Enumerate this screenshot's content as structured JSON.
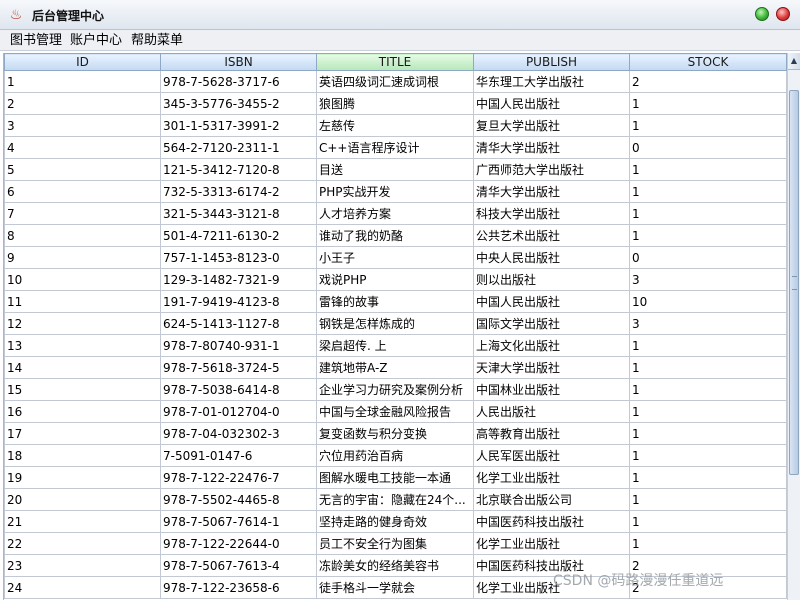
{
  "window": {
    "title": "后台管理中心"
  },
  "menu": {
    "items": [
      "图书管理",
      "账户中心",
      "帮助菜单"
    ]
  },
  "table": {
    "columns": [
      "ID",
      "ISBN",
      "TITLE",
      "PUBLISH",
      "STOCK"
    ],
    "sorted_column": "TITLE",
    "rows": [
      [
        "1",
        "978-7-5628-3717-6",
        "英语四级词汇速成词根",
        " 华东理工大学出版社",
        "2"
      ],
      [
        "2",
        "345-3-5776-3455-2",
        "狼图腾",
        "中国人民出版社",
        "1"
      ],
      [
        "3",
        "301-1-5317-3991-2",
        "左慈传",
        "复旦大学出版社",
        "1"
      ],
      [
        "4",
        "564-2-7120-2311-1",
        "C++语言程序设计",
        "清华大学出版社",
        "0"
      ],
      [
        "5",
        "121-5-3412-7120-8",
        "目送",
        "广西师范大学出版社",
        "1"
      ],
      [
        "6",
        "732-5-3313-6174-2",
        "PHP实战开发",
        "清华大学出版社",
        "1"
      ],
      [
        "7",
        "321-5-3443-3121-8",
        "人才培养方案",
        "科技大学出版社",
        "1"
      ],
      [
        "8",
        "501-4-7211-6130-2",
        "谁动了我的奶酪",
        "公共艺术出版社",
        "1"
      ],
      [
        "9",
        "757-1-1453-8123-0",
        "小王子",
        "中央人民出版社",
        "0"
      ],
      [
        "10",
        "129-3-1482-7321-9",
        "戏说PHP",
        "则以出版社",
        "3"
      ],
      [
        "11",
        "191-7-9419-4123-8",
        "雷锋的故事",
        "中国人民出版社",
        "10"
      ],
      [
        "12",
        "624-5-1413-1127-8",
        "钢铁是怎样炼成的",
        "国际文学出版社",
        "3"
      ],
      [
        "13",
        "978-7-80740-931-1",
        "梁启超传. 上",
        " 上海文化出版社",
        "1"
      ],
      [
        "14",
        "978-7-5618-3724-5",
        "建筑地带A-Z",
        " 天津大学出版社",
        "1"
      ],
      [
        "15",
        "978-7-5038-6414-8",
        "企业学习力研究及案例分析",
        "中国林业出版社",
        "1"
      ],
      [
        "16",
        "978-7-01-012704-0",
        "中国与全球金融风险报告",
        "人民出版社",
        "1"
      ],
      [
        "17",
        "978-7-04-032302-3",
        "复变函数与积分变换",
        "高等教育出版社",
        "1"
      ],
      [
        "18",
        "7-5091-0147-6",
        "穴位用药治百病",
        "人民军医出版社",
        "1"
      ],
      [
        "19",
        "978-7-122-22476-7",
        "图解水暖电工技能一本通",
        " 化学工业出版社",
        "1"
      ],
      [
        "20",
        "978-7-5502-4465-8",
        "无言的宇宙：隐藏在24个...",
        "北京联合出版公司",
        "1"
      ],
      [
        "21",
        "978-7-5067-7614-1",
        "坚持走路的健身奇效",
        " 中国医药科技出版社",
        "1"
      ],
      [
        "22",
        "978-7-122-22644-0",
        "员工不安全行为图集",
        "化学工业出版社",
        "1"
      ],
      [
        "23",
        "978-7-5067-7613-4",
        "冻龄美女的经络美容书",
        "中国医药科技出版社",
        "2"
      ],
      [
        "24",
        "978-7-122-23658-6",
        "徒手格斗一学就会",
        " 化学工业出版社",
        "2"
      ]
    ]
  },
  "watermark": "CSDN @码路漫漫任重道远",
  "icons": {
    "app": "java-coffee-icon",
    "maximize": "maximize-icon",
    "close": "close-icon",
    "scroll_up": "scroll-up-arrow-icon"
  }
}
